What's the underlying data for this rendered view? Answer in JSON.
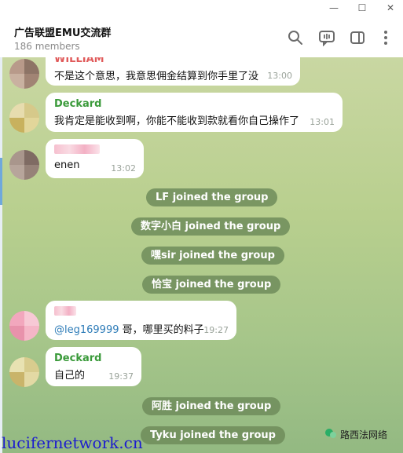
{
  "window": {
    "minimize": "—",
    "maximize": "☐",
    "close": "✕"
  },
  "header": {
    "title": "广告联盟EMU交流群",
    "subtitle": "186 members"
  },
  "messages": [
    {
      "sender": "WILLIAM",
      "text": "不是这个意思，我意思佣金结算到你手里了没",
      "time": "13:00"
    },
    {
      "sender": "Deckard",
      "text": "我肯定是能收到啊，你能不能收到款就看你自己操作了",
      "time": "13:01"
    },
    {
      "sender": "",
      "text": "enen",
      "time": "13:02"
    },
    {
      "sender": "",
      "mention": "@leg169999",
      "text": " 哥，哪里买的料子",
      "time": "19:27"
    },
    {
      "sender": "Deckard",
      "text": "自己的",
      "time": "19:37"
    }
  ],
  "service": [
    "LF joined the group",
    "数字小白 joined the group",
    "嘿sir joined the group",
    "恰宝 joined the group",
    "阿胜 joined the group",
    "Tyku joined the group"
  ],
  "watermark": {
    "left": "lucifernetwork.cn",
    "right": "路西法网络"
  },
  "colors": {
    "sender_red": "#e05a5a",
    "sender_green": "#3a9a3a",
    "mention": "#2e7cb8",
    "service_bg": "#6e8c5a"
  }
}
